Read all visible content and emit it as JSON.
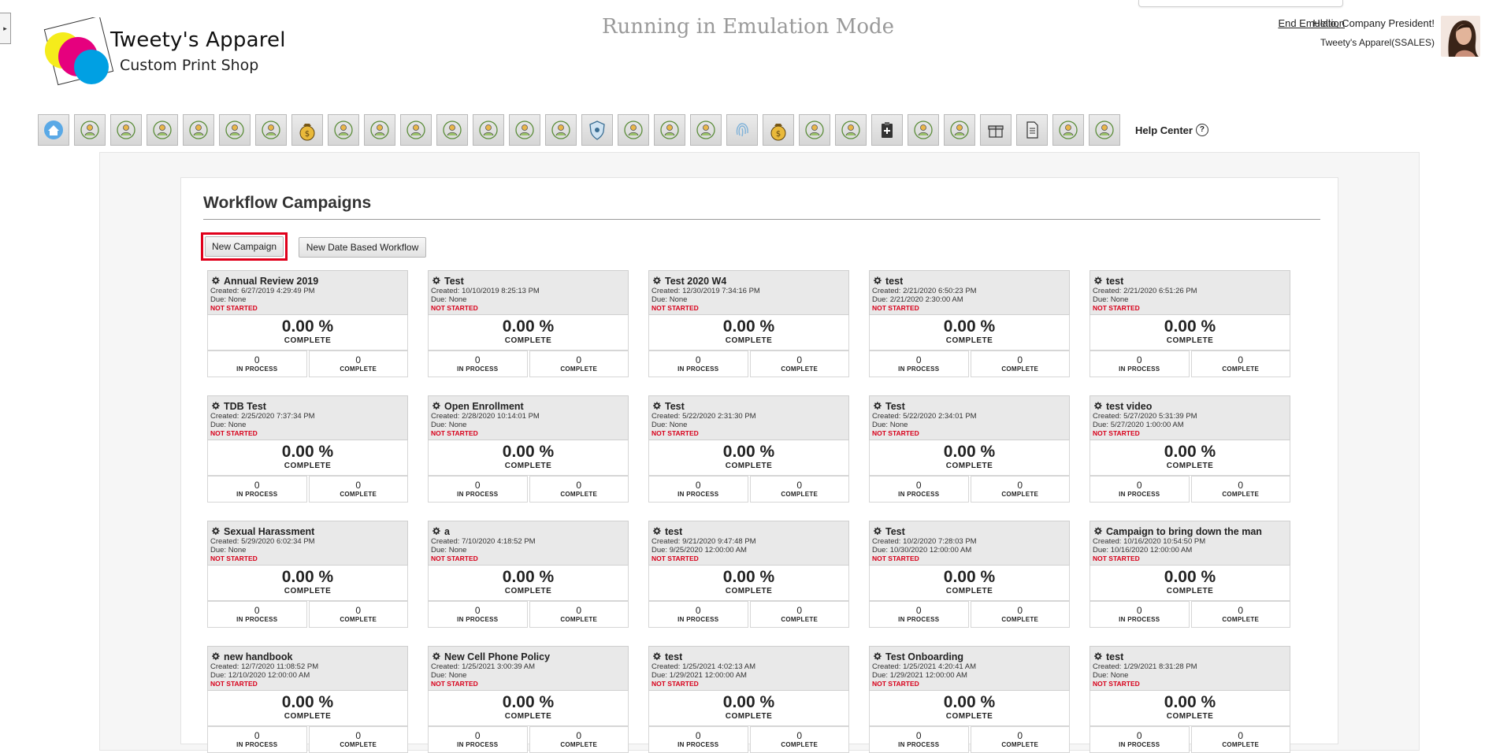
{
  "header": {
    "brand_name": "Tweety's Apparel",
    "brand_sub": "Custom Print Shop",
    "emulation_title": "Running in Emulation Mode",
    "end_emulation": "End Emulation",
    "greeting": "Hello, Company President!",
    "company": "Tweety's Apparel(SSALES)"
  },
  "toolbar": {
    "icons": [
      "home-icon",
      "goal-badge-icon",
      "gear-person-icon",
      "presentation-icon",
      "team-icon",
      "org-chart-icon",
      "document-pen-icon",
      "money-bag-icon",
      "search-person-icon",
      "target-icon",
      "target-arrows-icon",
      "growth-chart-icon",
      "target-people-icon",
      "arrows-person-icon",
      "idea-person-icon",
      "shield-icon",
      "award-person-icon",
      "swap-person-icon",
      "remove-person-icon",
      "fingerprint-icon",
      "money-bag-icon",
      "lightbulb-person-icon",
      "crowd-board-icon",
      "clipboard-plus-icon",
      "shield-person-icon",
      "hand-search-icon",
      "gift-icon",
      "document-icon",
      "group-board-icon",
      "inspect-board-icon"
    ],
    "help_center": "Help Center",
    "help_symbol": "?"
  },
  "workflow": {
    "title": "Workflow Campaigns",
    "new_campaign": "New Campaign",
    "new_date_workflow": "New Date Based Workflow",
    "pct_label": "COMPLETE",
    "in_process_label": "IN PROCESS",
    "complete_label": "COMPLETE"
  },
  "campaigns": [
    {
      "title": "Annual Review 2019",
      "created": "Created: 6/27/2019 4:29:49 PM",
      "due": "Due: None",
      "status": "NOT STARTED",
      "percent": "0.00 %",
      "in_process": "0",
      "complete": "0"
    },
    {
      "title": "Test",
      "created": "Created: 10/10/2019 8:25:13 PM",
      "due": "Due: None",
      "status": "NOT STARTED",
      "percent": "0.00 %",
      "in_process": "0",
      "complete": "0"
    },
    {
      "title": "Test 2020 W4",
      "created": "Created: 12/30/2019 7:34:16 PM",
      "due": "Due: None",
      "status": "NOT STARTED",
      "percent": "0.00 %",
      "in_process": "0",
      "complete": "0"
    },
    {
      "title": "test",
      "created": "Created: 2/21/2020 6:50:23 PM",
      "due": "Due: 2/21/2020 2:30:00 AM",
      "status": "NOT STARTED",
      "percent": "0.00 %",
      "in_process": "0",
      "complete": "0"
    },
    {
      "title": "test",
      "created": "Created: 2/21/2020 6:51:26 PM",
      "due": "Due: None",
      "status": "NOT STARTED",
      "percent": "0.00 %",
      "in_process": "0",
      "complete": "0"
    },
    {
      "title": "TDB Test",
      "created": "Created: 2/25/2020 7:37:34 PM",
      "due": "Due: None",
      "status": "NOT STARTED",
      "percent": "0.00 %",
      "in_process": "0",
      "complete": "0"
    },
    {
      "title": "Open Enrollment",
      "created": "Created: 2/28/2020 10:14:01 PM",
      "due": "Due: None",
      "status": "NOT STARTED",
      "percent": "0.00 %",
      "in_process": "0",
      "complete": "0"
    },
    {
      "title": "Test",
      "created": "Created: 5/22/2020 2:31:30 PM",
      "due": "Due: None",
      "status": "NOT STARTED",
      "percent": "0.00 %",
      "in_process": "0",
      "complete": "0"
    },
    {
      "title": "Test",
      "created": "Created: 5/22/2020 2:34:01 PM",
      "due": "Due: None",
      "status": "NOT STARTED",
      "percent": "0.00 %",
      "in_process": "0",
      "complete": "0"
    },
    {
      "title": "test video",
      "created": "Created: 5/27/2020 5:31:39 PM",
      "due": "Due: 5/27/2020 1:00:00 AM",
      "status": "NOT STARTED",
      "percent": "0.00 %",
      "in_process": "0",
      "complete": "0"
    },
    {
      "title": "Sexual Harassment",
      "created": "Created: 5/29/2020 6:02:34 PM",
      "due": "Due: None",
      "status": "NOT STARTED",
      "percent": "0.00 %",
      "in_process": "0",
      "complete": "0"
    },
    {
      "title": "a",
      "created": "Created: 7/10/2020 4:18:52 PM",
      "due": "Due: None",
      "status": "NOT STARTED",
      "percent": "0.00 %",
      "in_process": "0",
      "complete": "0"
    },
    {
      "title": "test",
      "created": "Created: 9/21/2020 9:47:48 PM",
      "due": "Due: 9/25/2020 12:00:00 AM",
      "status": "NOT STARTED",
      "percent": "0.00 %",
      "in_process": "0",
      "complete": "0"
    },
    {
      "title": "Test",
      "created": "Created: 10/2/2020 7:28:03 PM",
      "due": "Due: 10/30/2020 12:00:00 AM",
      "status": "NOT STARTED",
      "percent": "0.00 %",
      "in_process": "0",
      "complete": "0"
    },
    {
      "title": "Campaign to bring down the man",
      "created": "Created: 10/16/2020 10:54:50 PM",
      "due": "Due: 10/16/2020 12:00:00 AM",
      "status": "NOT STARTED",
      "percent": "0.00 %",
      "in_process": "0",
      "complete": "0"
    },
    {
      "title": "new handbook",
      "created": "Created: 12/7/2020 11:08:52 PM",
      "due": "Due: 12/10/2020 12:00:00 AM",
      "status": "NOT STARTED",
      "percent": "0.00 %",
      "in_process": "0",
      "complete": "0"
    },
    {
      "title": "New Cell Phone Policy",
      "created": "Created: 1/25/2021 3:00:39 AM",
      "due": "Due: None",
      "status": "NOT STARTED",
      "percent": "0.00 %",
      "in_process": "0",
      "complete": "0"
    },
    {
      "title": "test",
      "created": "Created: 1/25/2021 4:02:13 AM",
      "due": "Due: 1/29/2021 12:00:00 AM",
      "status": "NOT STARTED",
      "percent": "0.00 %",
      "in_process": "0",
      "complete": "0"
    },
    {
      "title": "Test Onboarding",
      "created": "Created: 1/25/2021 4:20:41 AM",
      "due": "Due: 1/29/2021 12:00:00 AM",
      "status": "NOT STARTED",
      "percent": "0.00 %",
      "in_process": "0",
      "complete": "0"
    },
    {
      "title": "test",
      "created": "Created: 1/29/2021 8:31:28 PM",
      "due": "Due: None",
      "status": "NOT STARTED",
      "percent": "0.00 %",
      "in_process": "0",
      "complete": "0"
    }
  ],
  "colors": {
    "status_red": "#d8001a",
    "highlight_red": "#e0001b",
    "logo_yellow": "#f5ec1b",
    "logo_magenta": "#e6007e",
    "logo_cyan": "#00a0e3"
  }
}
